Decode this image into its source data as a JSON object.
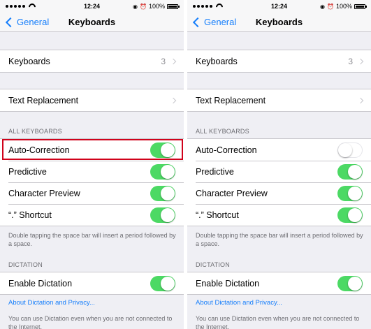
{
  "panels": [
    {
      "status": {
        "time": "12:24",
        "battery": "100%"
      },
      "nav": {
        "back_label": "General",
        "title": "Keyboards"
      },
      "keyboards_row": {
        "label": "Keyboards",
        "value": "3"
      },
      "text_replacement_row": {
        "label": "Text Replacement"
      },
      "all_keyboards_header": "ALL KEYBOARDS",
      "toggles": [
        {
          "label": "Auto-Correction",
          "on": true
        },
        {
          "label": "Predictive",
          "on": true
        },
        {
          "label": "Character Preview",
          "on": true
        },
        {
          "label": "“.” Shortcut",
          "on": true
        }
      ],
      "shortcut_footer": "Double tapping the space bar will insert a period followed by a space.",
      "dictation_header": "DICTATION",
      "dictation_row": {
        "label": "Enable Dictation",
        "on": true
      },
      "dictation_link": "About Dictation and Privacy...",
      "dictation_footer": "You can use Dictation even when you are not connected to the Internet."
    },
    {
      "status": {
        "time": "12:24",
        "battery": "100%"
      },
      "nav": {
        "back_label": "General",
        "title": "Keyboards"
      },
      "keyboards_row": {
        "label": "Keyboards",
        "value": "3"
      },
      "text_replacement_row": {
        "label": "Text Replacement"
      },
      "all_keyboards_header": "ALL KEYBOARDS",
      "toggles": [
        {
          "label": "Auto-Correction",
          "on": false
        },
        {
          "label": "Predictive",
          "on": true
        },
        {
          "label": "Character Preview",
          "on": true
        },
        {
          "label": "“.” Shortcut",
          "on": true
        }
      ],
      "shortcut_footer": "Double tapping the space bar will insert a period followed by a space.",
      "dictation_header": "DICTATION",
      "dictation_row": {
        "label": "Enable Dictation",
        "on": true
      },
      "dictation_link": "About Dictation and Privacy...",
      "dictation_footer": "You can use Dictation even when you are not connected to the Internet."
    }
  ],
  "colors": {
    "toggle_on": "#4cd964",
    "link": "#157efb",
    "highlight": "#d0021b",
    "background": "#efeff4"
  },
  "icons": {
    "back": "chevron-left-icon",
    "disclosure": "chevron-right-icon",
    "alarm": "alarm-icon",
    "lock": "rotation-lock-icon"
  }
}
